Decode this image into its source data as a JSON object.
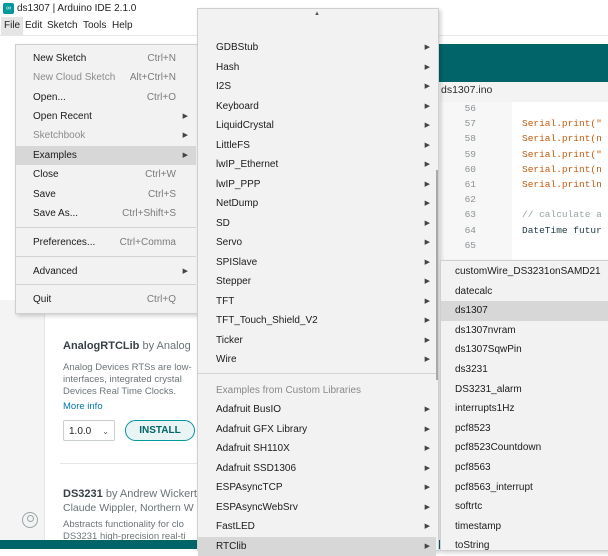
{
  "window": {
    "title": "ds1307 | Arduino IDE 2.1.0",
    "logo": "arduino-logo"
  },
  "menubar": [
    "File",
    "Edit",
    "Sketch",
    "Tools",
    "Help"
  ],
  "file_menu": {
    "items": [
      {
        "label": "New Sketch",
        "shortcut": "Ctrl+N"
      },
      {
        "label": "New Cloud Sketch",
        "shortcut": "Alt+Ctrl+N",
        "disabled": true
      },
      {
        "label": "Open...",
        "shortcut": "Ctrl+O"
      },
      {
        "label": "Open Recent",
        "submenu": true
      },
      {
        "label": "Sketchbook",
        "submenu": true,
        "disabled": true
      },
      {
        "label": "Examples",
        "submenu": true,
        "highlighted": true
      },
      {
        "label": "Close",
        "shortcut": "Ctrl+W"
      },
      {
        "label": "Save",
        "shortcut": "Ctrl+S"
      },
      {
        "label": "Save As...",
        "shortcut": "Ctrl+Shift+S"
      },
      {
        "label": "Preferences...",
        "shortcut": "Ctrl+Comma"
      },
      {
        "label": "Advanced",
        "submenu": true
      },
      {
        "label": "Quit",
        "shortcut": "Ctrl+Q"
      }
    ]
  },
  "examples_menu": {
    "items": [
      "GDBStub",
      "Hash",
      "I2S",
      "Keyboard",
      "LiquidCrystal",
      "LittleFS",
      "lwIP_Ethernet",
      "lwIP_PPP",
      "NetDump",
      "SD",
      "Servo",
      "SPISlave",
      "Stepper",
      "TFT",
      "TFT_Touch_Shield_V2",
      "Ticker",
      "Wire"
    ],
    "custom_heading": "Examples from Custom Libraries",
    "custom_items": [
      "Adafruit BusIO",
      "Adafruit GFX Library",
      "Adafruit SH110X",
      "Adafruit SSD1306",
      "ESPAsyncTCP",
      "ESPAsyncWebSrv",
      "FastLED",
      "RTClib"
    ],
    "highlighted": "RTClib"
  },
  "rtclib_menu": {
    "items": [
      "customWire_DS3231onSAMD21",
      "datecalc",
      "ds1307",
      "ds1307nvram",
      "ds1307SqwPin",
      "ds3231",
      "DS3231_alarm",
      "interrupts1Hz",
      "pcf8523",
      "pcf8523Countdown",
      "pcf8563",
      "pcf8563_interrupt",
      "softrtc",
      "timestamp",
      "toString"
    ],
    "highlighted": "ds1307"
  },
  "editor": {
    "tab": "ds1307.ino",
    "line_numbers": [
      "56",
      "57",
      "58",
      "59",
      "60",
      "61",
      "62",
      "63",
      "64",
      "65"
    ],
    "lines": [
      "",
      "Serial.print(\"",
      "Serial.print(n",
      "Serial.print(\"",
      "Serial.print(n",
      "Serial.println",
      "",
      "// calculate a",
      "DateTime futur",
      ""
    ]
  },
  "library_manager": {
    "lib1": {
      "name": "AnalogRTCLib",
      "by": "by Analog",
      "desc1": "Analog Devices RTSs are low-",
      "desc2": "interfaces, integrated crystal",
      "desc3": "Devices Real Time Clocks.",
      "more": "More info",
      "version": "1.0.0",
      "install": "INSTALL"
    },
    "lib2": {
      "name": "DS3231",
      "by": "by Andrew Wickert",
      "by2": "Claude Wippler, Northern W",
      "desc1": "Abstracts functionality for clo",
      "desc2": "DS3231 high-precision real-ti"
    }
  },
  "colors": {
    "teal": "#006468",
    "accent": "#00979d",
    "menu_bg": "#f2f2f2",
    "highlight": "#d7d7d7"
  }
}
